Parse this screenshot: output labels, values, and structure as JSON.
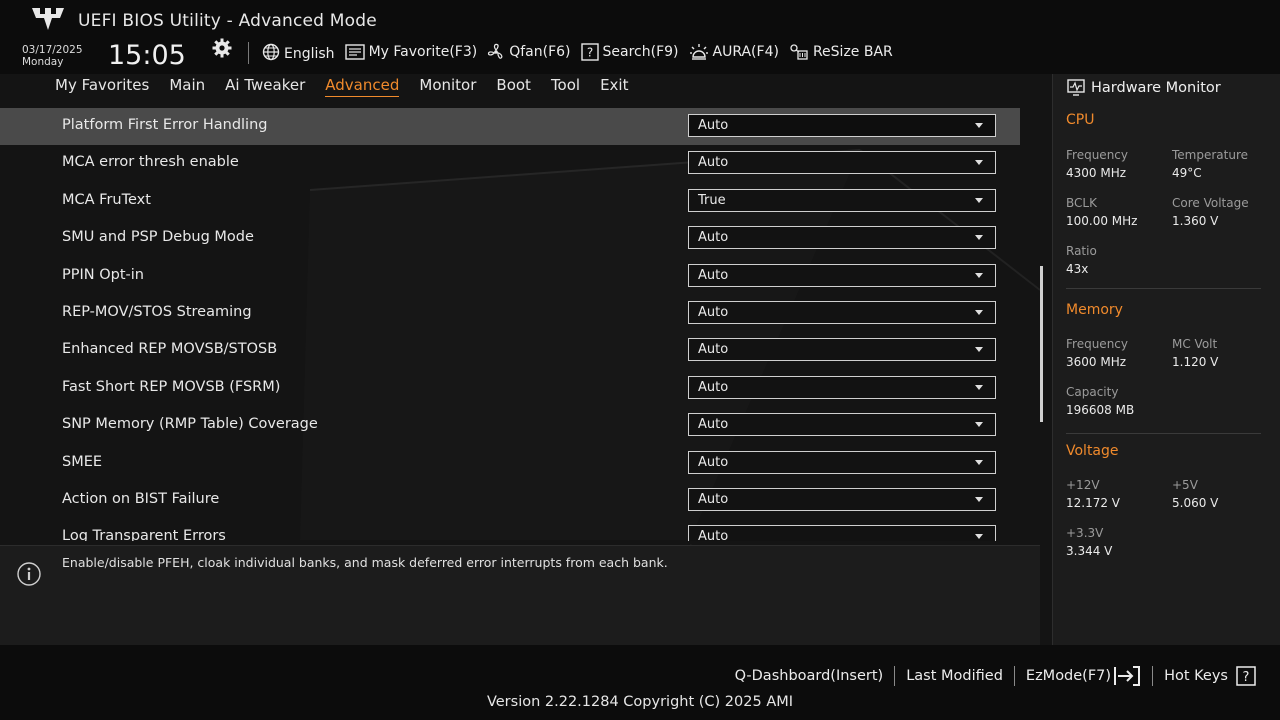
{
  "header": {
    "app_title": "UEFI BIOS Utility - Advanced Mode",
    "date": "03/17/2025",
    "day": "Monday",
    "time": "15:05",
    "toolbar": [
      {
        "label": "English",
        "icon": "globe-icon"
      },
      {
        "label": "My Favorite(F3)",
        "icon": "favorite-icon"
      },
      {
        "label": "Qfan(F6)",
        "icon": "fan-icon"
      },
      {
        "label": "Search(F9)",
        "icon": "search-help-icon"
      },
      {
        "label": "AURA(F4)",
        "icon": "aura-light-icon"
      },
      {
        "label": "ReSize BAR",
        "icon": "resize-bar-icon"
      }
    ]
  },
  "nav": {
    "tabs": [
      "My Favorites",
      "Main",
      "Ai Tweaker",
      "Advanced",
      "Monitor",
      "Boot",
      "Tool",
      "Exit"
    ],
    "active": "Advanced"
  },
  "settings": [
    {
      "label": "Platform First Error Handling",
      "value": "Auto",
      "selected": true
    },
    {
      "label": "MCA error thresh enable",
      "value": "Auto"
    },
    {
      "label": "MCA FruText",
      "value": "True"
    },
    {
      "label": "SMU and PSP Debug Mode",
      "value": "Auto"
    },
    {
      "label": "PPIN Opt-in",
      "value": "Auto"
    },
    {
      "label": "REP-MOV/STOS Streaming",
      "value": "Auto"
    },
    {
      "label": "Enhanced REP MOVSB/STOSB",
      "value": "Auto"
    },
    {
      "label": "Fast Short REP MOVSB (FSRM)",
      "value": "Auto"
    },
    {
      "label": "SNP Memory (RMP Table) Coverage",
      "value": "Auto"
    },
    {
      "label": "SMEE",
      "value": "Auto"
    },
    {
      "label": "Action on BIST Failure",
      "value": "Auto"
    },
    {
      "label": "Log Transparent Errors",
      "value": "Auto"
    }
  ],
  "help_text": "Enable/disable PFEH, cloak individual banks, and mask deferred error interrupts from each bank.",
  "hardware_monitor": {
    "title": "Hardware Monitor",
    "cpu": {
      "title": "CPU",
      "frequency_label": "Frequency",
      "frequency": "4300 MHz",
      "temperature_label": "Temperature",
      "temperature": "49°C",
      "bclk_label": "BCLK",
      "bclk": "100.00 MHz",
      "core_voltage_label": "Core Voltage",
      "core_voltage": "1.360 V",
      "ratio_label": "Ratio",
      "ratio": "43x"
    },
    "memory": {
      "title": "Memory",
      "frequency_label": "Frequency",
      "frequency": "3600 MHz",
      "mc_volt_label": "MC Volt",
      "mc_volt": "1.120 V",
      "capacity_label": "Capacity",
      "capacity": "196608 MB"
    },
    "voltage": {
      "title": "Voltage",
      "v12_label": "+12V",
      "v12": "12.172 V",
      "v5_label": "+5V",
      "v5": "5.060 V",
      "v33_label": "+3.3V",
      "v33": "3.344 V"
    }
  },
  "footer": {
    "qdashboard": "Q-Dashboard(Insert)",
    "last_modified": "Last Modified",
    "ezmode": "EzMode(F7)",
    "hotkeys": "Hot Keys",
    "version": "Version 2.22.1284 Copyright (C) 2025 AMI"
  },
  "colors": {
    "accent": "#f08a2c",
    "selected_row": "#4a4a4a",
    "background": "#141414"
  }
}
